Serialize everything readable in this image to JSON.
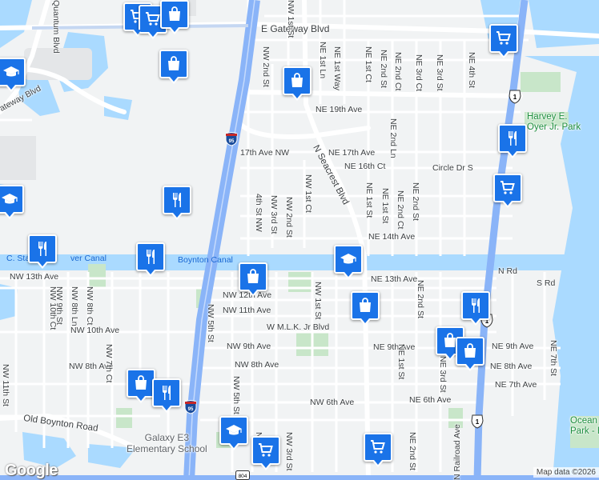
{
  "colors": {
    "land": "#f1f3f4",
    "water": "#aadaff",
    "park": "#c8e6c9",
    "highway": "#8ab4f8",
    "road": "#ffffff",
    "pin": "#1a73e8"
  },
  "streets": {
    "e_gateway": "E Gateway Blvd",
    "gateway_w": "ateway Blvd",
    "quantum": "Quantum Blvd",
    "nw_2nd_st_top": "NW 2nd St",
    "nw_1st_st_top": "NW 1st St",
    "ne_1st_ln": "NE 1st Ln",
    "ne_1st_way": "NE 1st Way",
    "ne_1st_ct_top": "NE 1st Ct",
    "ne_2nd_st_top": "NE 2nd St",
    "ne_2nd_ct_top": "NE 2nd Ct",
    "ne_3rd_ct": "NE 3rd Ct",
    "ne_3rd_st_top": "NE 3rd St",
    "ne_4th_st": "NE 4th St",
    "ne_19th": "NE 19th Ave",
    "nw_17th": "17th Ave NW",
    "ne_17th": "NE 17th Ave",
    "ne_16th_ct": "NE 16th Ct",
    "circle_dr": "Circle Dr S",
    "seacrest": "N Seacrest Blvd",
    "ne_2nd_ln": "NE 2nd Ln",
    "nw_1st_ct": "NW 1st Ct",
    "nw_4th_st": "4th St NW",
    "nw_3rd_st": "NW 3rd St",
    "nw_2nd_st": "NW 2nd St",
    "ne_1st_st": "NE 1st St",
    "ne_1st_st_b": "NE 1st St",
    "ne_2nd_ct": "NE 2nd Ct",
    "ne_2nd_st": "NE 2nd St",
    "ne_14th": "NE 14th Ave",
    "canal_w": "C. Sta",
    "canal_mid": "ver Canal",
    "boynton_canal": "Boynton Canal",
    "n_rd": "N Rd",
    "s_rd": "S Rd",
    "nw_13th": "NW 13th Ave",
    "ne_13th": "NE 13th Ave",
    "nw_12th": "NW 12th Ave",
    "nw_11th": "NW 11th Ave",
    "nw_10th": "NW 10th Ave",
    "mlk": "W M.L.K. Jr Blvd",
    "nw_9th": "NW 9th Ave",
    "ne_9th": "NE 9th Ave",
    "ne_9th_e": "NE 9th Ave",
    "nw_8th": "NW 8th Ave",
    "nw_8th_w": "NW 8th Ave",
    "ne_8th": "NE 8th Ave",
    "ne_7th": "NE 7th Ave",
    "nw_6th": "NW 6th Ave",
    "ne_6th": "NE 6th Ave",
    "nw_10th_ct": "NW 10th Ct",
    "nw_8th_ln": "NW 8th Ln",
    "nw_9th_st": "NW 9th St",
    "nw_8th_ct": "NW 8th Ct",
    "nw_7th_ct": "NW 7th Ct",
    "nw_11th_st": "NW 11th St",
    "nw_5th_st": "NW 5th St",
    "nw_5th_st_b": "NW 5th St",
    "nw_1st_st_mid": "NW 1st St",
    "ne_2nd_st_mid": "NE 2nd St",
    "ne_1st_st_low": "NE 1st St",
    "ne_3rd_st": "NE 3rd St",
    "ne_7th_st": "NE 7th St",
    "n_railroad": "N Railroad Ave",
    "nw_3rd_st_low": "NW 3rd St",
    "ne_2nd_st_low": "NE 2nd St",
    "old_boynton": "Old Boynton Road",
    "nw_1st_st_bot": "NW",
    "nw_11th_st_b": "NW 11th St"
  },
  "places": {
    "harvey_park": "Harvey E.\nOyer Jr. Park",
    "ocean_park": "Ocean\nPark - Bo",
    "galaxy_school": "Galaxy E3\nElementary School"
  },
  "shields": {
    "i95_top": "95",
    "i95_bottom": "95",
    "us1_top": "1",
    "us1_mid": "1",
    "us1_bottom": "1",
    "sr804": "804"
  },
  "pins": [
    {
      "type": "shopping-cart",
      "label": "shopping-cart-pin"
    },
    {
      "type": "shopping-cart",
      "label": "shopping-cart-pin"
    },
    {
      "type": "shopping-cart",
      "label": "shopping-cart-pin"
    },
    {
      "type": "shopping-cart",
      "label": "shopping-cart-pin"
    },
    {
      "type": "shopping-cart",
      "label": "shopping-cart-pin"
    },
    {
      "type": "shopping-cart",
      "label": "shopping-cart-pin"
    },
    {
      "type": "shopping-bag",
      "label": "shopping-bag-pin"
    },
    {
      "type": "shopping-bag",
      "label": "shopping-bag-pin"
    },
    {
      "type": "shopping-bag",
      "label": "shopping-bag-pin"
    },
    {
      "type": "shopping-bag",
      "label": "shopping-bag-pin"
    },
    {
      "type": "shopping-bag",
      "label": "shopping-bag-pin"
    },
    {
      "type": "shopping-bag",
      "label": "shopping-bag-pin"
    },
    {
      "type": "shopping-bag",
      "label": "shopping-bag-pin"
    },
    {
      "type": "restaurant",
      "label": "restaurant-pin"
    },
    {
      "type": "restaurant",
      "label": "restaurant-pin"
    },
    {
      "type": "restaurant",
      "label": "restaurant-pin"
    },
    {
      "type": "restaurant",
      "label": "restaurant-pin"
    },
    {
      "type": "restaurant",
      "label": "restaurant-pin"
    },
    {
      "type": "restaurant",
      "label": "restaurant-pin"
    },
    {
      "type": "school",
      "label": "school-pin"
    },
    {
      "type": "school",
      "label": "school-pin"
    },
    {
      "type": "school",
      "label": "school-pin"
    },
    {
      "type": "school",
      "label": "school-pin"
    }
  ],
  "branding": {
    "logo": "Google",
    "attribution": "Map data ©2026"
  }
}
